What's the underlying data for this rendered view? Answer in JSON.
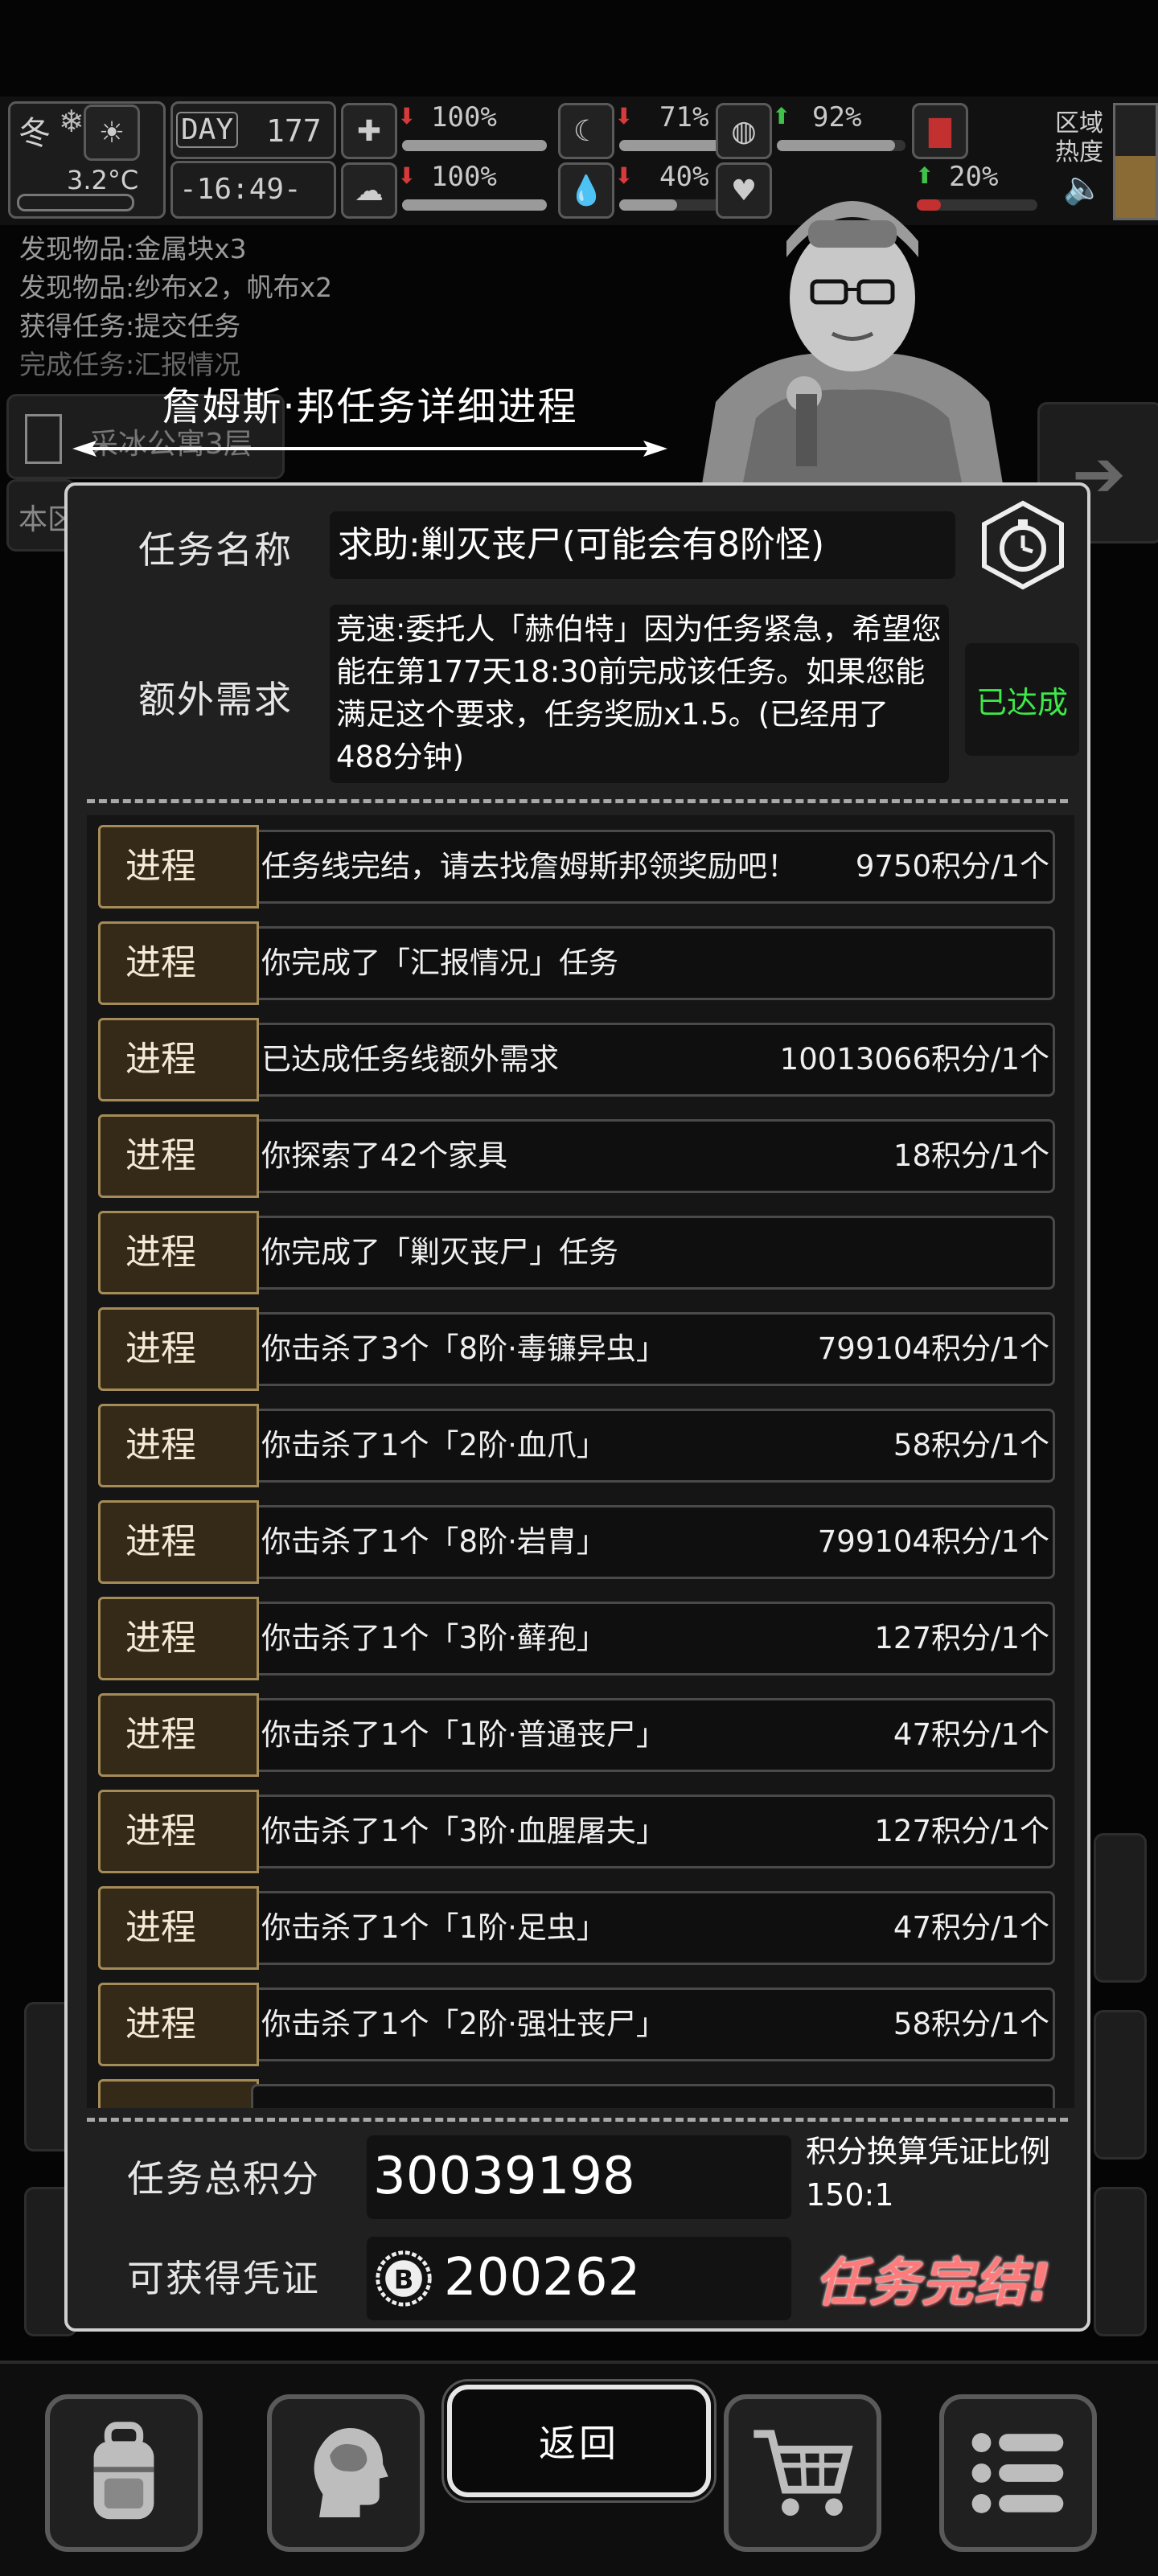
{
  "status": {
    "season": "冬",
    "temperature": "3.2°C",
    "day_label": "DAY",
    "day_number": "177",
    "clock": "-16:49-",
    "stats_row1": [
      {
        "icon": "medkit-icon",
        "arrow": "down",
        "value": "100%",
        "level": 1.0
      },
      {
        "icon": "stomach-icon",
        "arrow": "down",
        "value": "71%",
        "level": 0.71
      },
      {
        "icon": "capsule-icon",
        "arrow": "up",
        "value": "92%",
        "level": 0.92
      }
    ],
    "stats_row2": [
      {
        "icon": "brain-icon",
        "arrow": "down",
        "value": "100%",
        "level": 1.0
      },
      {
        "icon": "water-drop-icon",
        "arrow": "down",
        "value": "40%",
        "level": 0.4
      },
      {
        "icon": "heart-icon",
        "arrow": "up",
        "value": "20%",
        "level": 0.2
      }
    ],
    "area_heat_label": "区域\n热度"
  },
  "log": [
    "发现物品:金属块x3",
    "发现物品:纱布x2，帆布x2",
    "获得任务:提交任务",
    "完成任务:汇报情况"
  ],
  "background": {
    "location": "采冰公寓3层",
    "side_label": "本区"
  },
  "dialog": {
    "title": "詹姆斯·邦任务详细进程",
    "task_name_label": "任务名称",
    "task_name": "求助:剿灭丧尸(可能会有8阶怪)",
    "extra_label": "额外需求",
    "extra_text": "竞速:委托人「赫伯特」因为任务紧急，希望您能在第177天18:30前完成该任务。如果您能满足这个要求，任务奖励x1.5。(已经用了488分钟)",
    "extra_status": "已达成",
    "progress_tag": "进程",
    "progress": [
      {
        "text": "任务线完结，请去找詹姆斯邦领奖励吧！",
        "points": "9750积分/1个"
      },
      {
        "text": "你完成了「汇报情况」任务",
        "points": ""
      },
      {
        "text": "已达成任务线额外需求",
        "points": "10013066积分/1个"
      },
      {
        "text": "你探索了42个家具",
        "points": "18积分/1个"
      },
      {
        "text": "你完成了「剿灭丧尸」任务",
        "points": ""
      },
      {
        "text": "你击杀了3个「8阶·毒镰异虫」",
        "points": "799104积分/1个"
      },
      {
        "text": "你击杀了1个「2阶·血爪」",
        "points": "58积分/1个"
      },
      {
        "text": "你击杀了1个「8阶·岩胄」",
        "points": "799104积分/1个"
      },
      {
        "text": "你击杀了1个「3阶·藓孢」",
        "points": "127积分/1个"
      },
      {
        "text": "你击杀了1个「1阶·普通丧尸」",
        "points": "47积分/1个"
      },
      {
        "text": "你击杀了1个「3阶·血腥屠夫」",
        "points": "127积分/1个"
      },
      {
        "text": "你击杀了1个「1阶·足虫」",
        "points": "47积分/1个"
      },
      {
        "text": "你击杀了1个「2阶·强壮丧尸」",
        "points": "58积分/1个"
      }
    ],
    "total_label": "任务总积分",
    "total_value": "30039198",
    "ratio_label": "积分换算凭证比例",
    "ratio_value": "150:1",
    "voucher_label": "可获得凭证",
    "voucher_value": "200262",
    "complete_label": "任务完结!"
  },
  "nav": {
    "back_label": "返回",
    "items": [
      "backpack-icon",
      "brain-icon",
      "cart-icon",
      "menu-icon"
    ]
  },
  "colors": {
    "panel_bg": "#202020",
    "tag_bg": "#342a17",
    "tag_border": "#a58b57",
    "success": "#3ee84a",
    "complete": "#ff7b7b"
  }
}
